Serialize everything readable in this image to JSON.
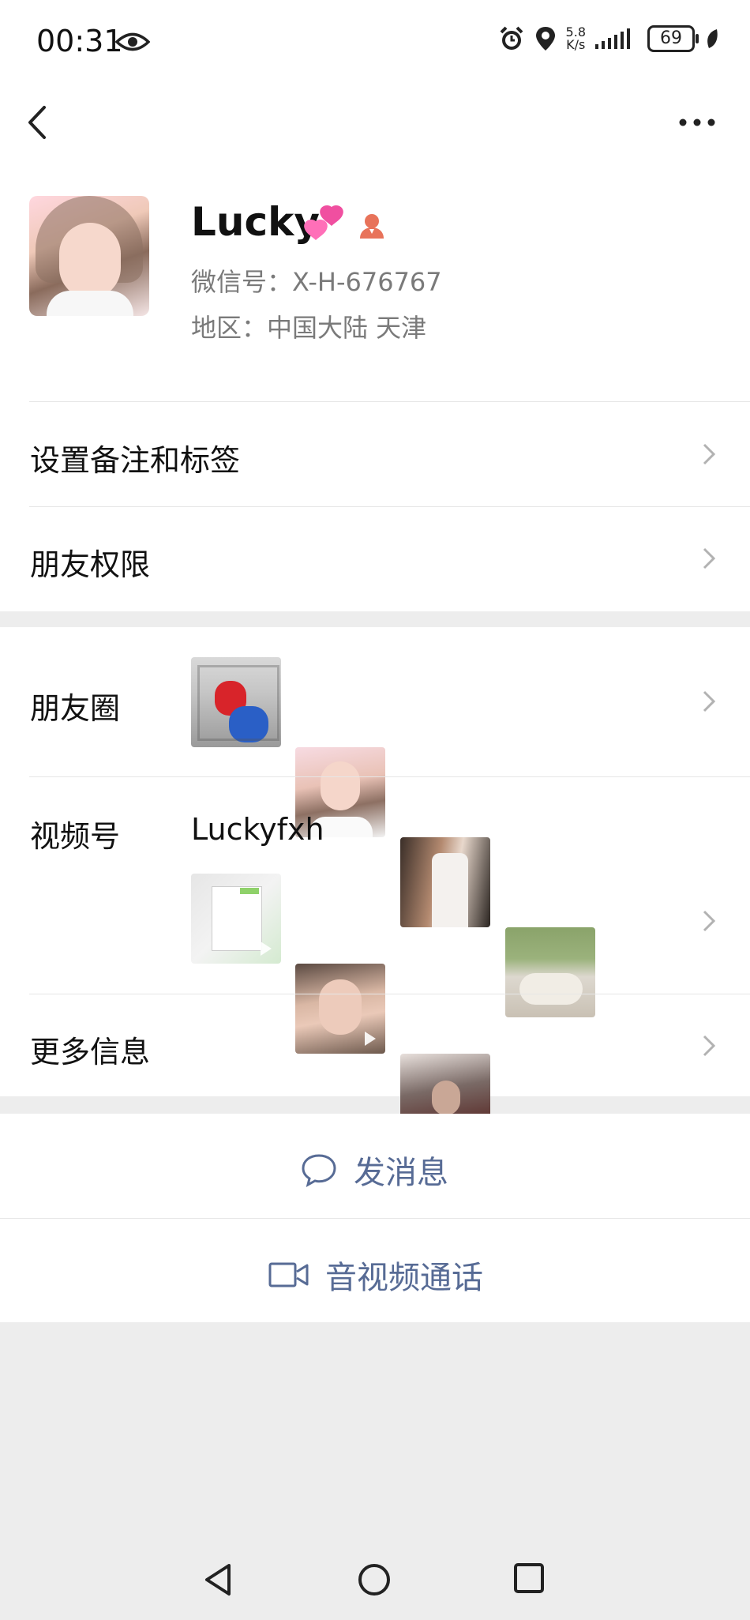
{
  "status_bar": {
    "time": "00:31",
    "net_speed_value": "5.8",
    "net_speed_unit": "K/s",
    "battery": "69"
  },
  "profile": {
    "name": "Lucky",
    "wechat_id": "微信号：X-H-676767",
    "region": "地区：中国大陆  天津"
  },
  "rows": {
    "remark": "设置备注和标签",
    "permissions": "朋友权限",
    "moments": "朋友圈",
    "channels": "视频号",
    "channels_name": "Luckyfxh",
    "more_info": "更多信息"
  },
  "actions": {
    "message": "发消息",
    "call": "音视频通话"
  },
  "colors": {
    "link_blue": "#576b95",
    "background": "#ededed",
    "badge_orange": "#e8735a"
  },
  "icons": [
    "back-icon",
    "more-icon",
    "eye-icon",
    "alarm-icon",
    "location-icon",
    "signal-icon",
    "battery-icon",
    "leaf-icon",
    "heart-emoji-icon",
    "agent-icon",
    "chevron-right-icon",
    "chat-bubble-icon",
    "video-camera-icon",
    "nav-back-icon",
    "nav-home-icon",
    "nav-recents-icon"
  ]
}
